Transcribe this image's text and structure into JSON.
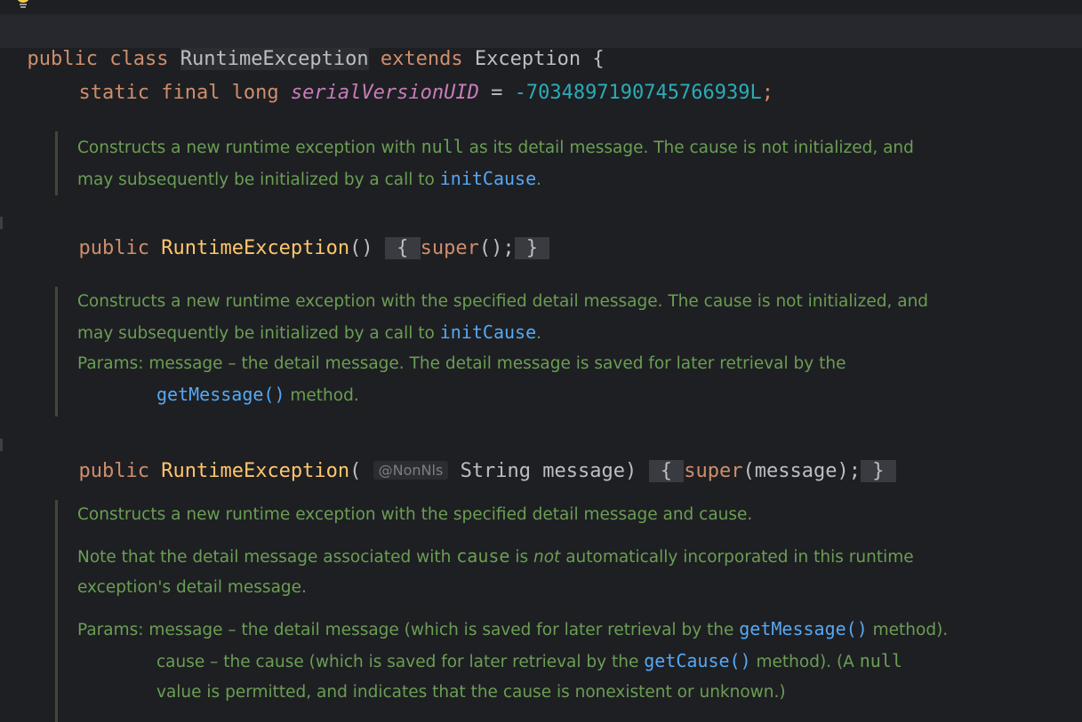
{
  "class_decl": {
    "public": "public",
    "class": "class",
    "name": "RuntimeException",
    "extends": "extends",
    "super": "Exception",
    "brace": " {"
  },
  "field_decl": {
    "modifiers": "static final long",
    "name": "serialVersionUID",
    "eq": " = ",
    "value": "-7034897190745766939L",
    "semi": ";"
  },
  "doc1": {
    "l1a": "Constructs a new runtime exception with ",
    "l1code": "null",
    "l1b": " as its detail message. The cause is not initialized, and",
    "l2a": "may subsequently be initialized by a call to ",
    "l2link": "initCause",
    "l2b": "."
  },
  "ctor1": {
    "public": "public",
    "name": "RuntimeException",
    "parens": "()",
    "open": "{",
    "super": "super",
    "call": "();",
    "close": "}"
  },
  "doc2": {
    "l1": "Constructs a new runtime exception with the specified detail message. The cause is not initialized, and",
    "l2a": "may subsequently be initialized by a call to ",
    "l2link": "initCause",
    "l2b": ".",
    "params_label": "Params: ",
    "p1": "message – the detail message. The detail message is saved for later retrieval by the",
    "p1link": "getMessage()",
    "p1end": " method."
  },
  "ctor2": {
    "public": "public",
    "name": "RuntimeException",
    "open_paren": "(",
    "annotation": "@NonNls",
    "params": "String message)",
    "open": "{",
    "super": "super",
    "call": "(message);",
    "close": "}"
  },
  "doc3": {
    "l1": "Constructs a new runtime exception with the specified detail message and cause.",
    "l2a": "Note that the detail message associated with ",
    "l2code": "cause",
    "l2b": " is ",
    "l2it": "not",
    "l2c": " automatically incorporated in this runtime",
    "l3": "exception's detail message.",
    "params_label": "Params: ",
    "p1a": "message – the detail message (which is saved for later retrieval by the ",
    "p1link": "getMessage()",
    "p1b": " method).",
    "p2a": "cause – the cause (which is saved for later retrieval by the ",
    "p2link": "getCause()",
    "p2b": " method). (A ",
    "p2code": "null",
    "p3": "value is permitted, and indicates that the cause is nonexistent or unknown.)"
  },
  "colors": {
    "background": "#1e1f22",
    "keyword": "#cf8e6d",
    "function": "#ffc66d",
    "field": "#c77dbb",
    "number": "#2aacb8",
    "doc": "#6a9e54",
    "doc_link": "#56a8f5"
  }
}
